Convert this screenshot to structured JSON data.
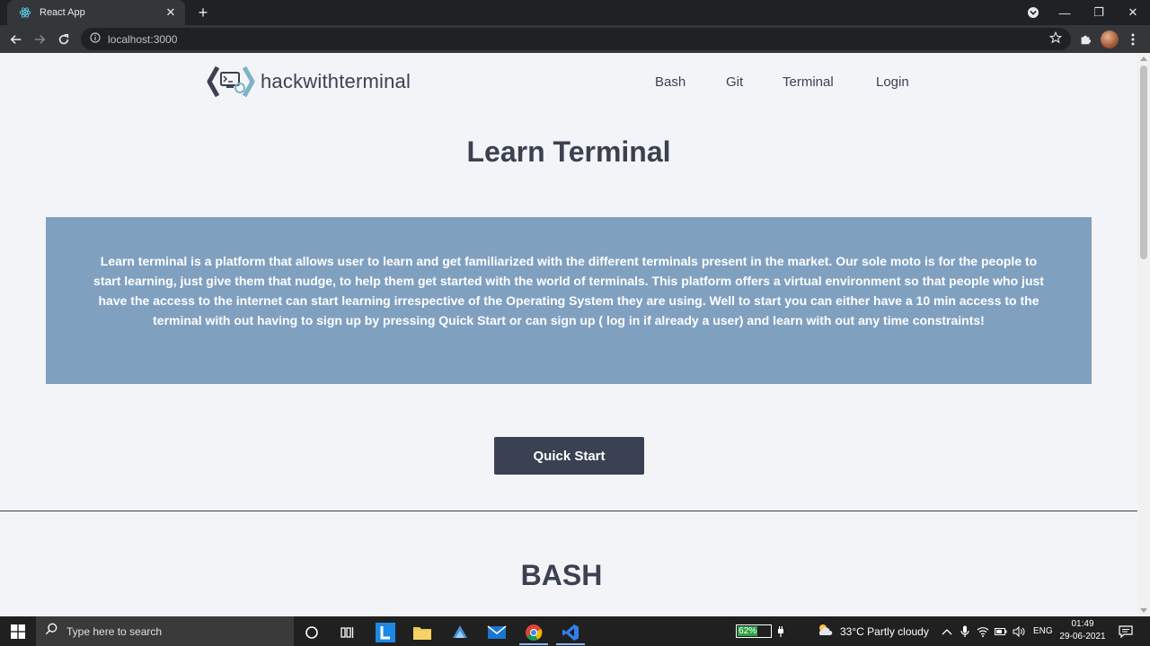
{
  "browser": {
    "tab_title": "React App",
    "url": "localhost:3000"
  },
  "header": {
    "brand": "hackwithterminal",
    "nav": [
      "Bash",
      "Git",
      "Terminal",
      "Login"
    ]
  },
  "hero": {
    "title": "Learn Terminal",
    "description": "Learn terminal is a platform that allows user to learn and get familiarized with the different terminals present in the market. Our sole moto is for the people to start learning, just give them that nudge, to help them get started with the world of terminals. This platform offers a virtual environment so that people who just have the access to the internet can start learning irrespective of the Operating System they are using. Well to start you can either have a 10 min access to the terminal with out having to sign up by pressing Quick Start or can sign up ( log in if already a user) and learn with out any time constraints!",
    "cta": "Quick Start"
  },
  "section": {
    "title": "BASH"
  },
  "taskbar": {
    "search_placeholder": "Type here to search",
    "battery": "62%",
    "weather": "33°C  Partly cloudy",
    "language": "ENG",
    "time": "01:49",
    "date": "29-06-2021"
  },
  "colors": {
    "accent_box": "#80a0c0",
    "button": "#3a4152",
    "text": "#3b4150"
  }
}
